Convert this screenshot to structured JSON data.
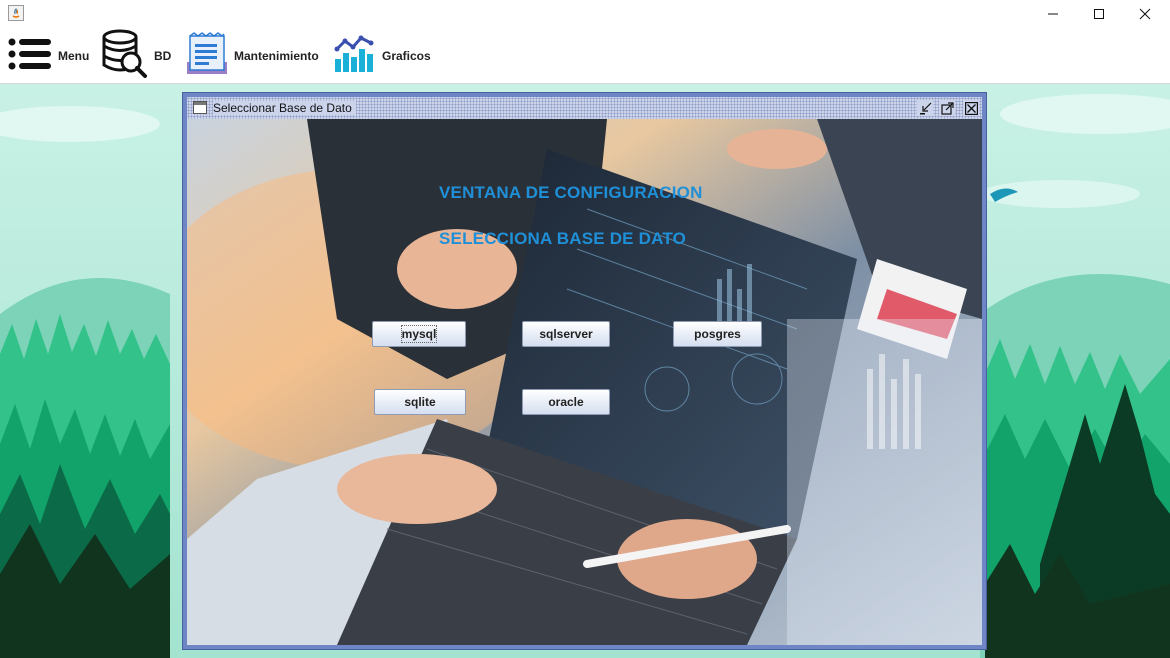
{
  "window": {
    "controls": {
      "minimize": "minimize-icon",
      "maximize": "maximize-icon",
      "close": "close-icon"
    }
  },
  "menubar": {
    "items": [
      {
        "label": "Menu",
        "icon": "hamburger-list-icon"
      },
      {
        "label": "BD",
        "icon": "database-search-icon"
      },
      {
        "label": "Mantenimiento",
        "icon": "document-icon"
      },
      {
        "label": "Graficos",
        "icon": "bar-chart-icon"
      }
    ]
  },
  "internal_frame": {
    "title": "Seleccionar Base de Dato",
    "heading_1": "VENTANA DE CONFIGURACION",
    "heading_2": "SELECCIONA BASE DE DATO",
    "buttons": {
      "mysql": "mysql",
      "sqlserver": "sqlserver",
      "posgres": "posgres",
      "sqlite": "sqlite",
      "oracle": "oracle"
    },
    "focused_button": "mysql"
  },
  "colors": {
    "heading": "#1f90d8",
    "frame_border": "#6f86c6",
    "title_bar": "#ccd4ec"
  }
}
